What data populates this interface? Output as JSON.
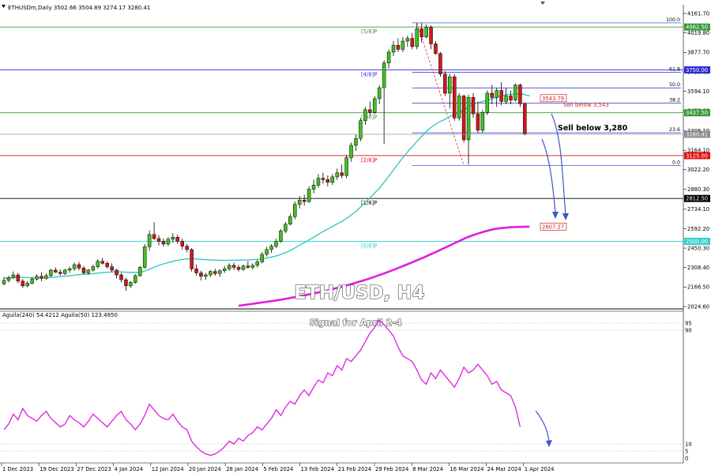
{
  "header": {
    "symbol_text": "ETHUSDm,Daily  3502.66 3504.89 3274.17 3280.41",
    "indicator_text": "Aguila(240) 54.4212  Aguila(50) 123.4950"
  },
  "watermark": {
    "title": "ETH/USD, H4",
    "subtitle": "Signal for April 2-4"
  },
  "colors": {
    "bull": "#3fc21f",
    "bear": "#d31818",
    "ema_fast": "#33c9c2",
    "ema_slow": "#e01ce0",
    "murray_green": "#3a9a3a",
    "murray_blue": "#2b2bd6",
    "murray_red": "#e01010",
    "murray_black": "#000000",
    "murray_cyan": "#2fd0d0",
    "arrow": "#3d55c8",
    "oscillator": "#e01ce0"
  },
  "price_axis": {
    "ticks": [
      "4161.70",
      "4019.80",
      "3877.70",
      "3735.60",
      "3594.10",
      "3452.00",
      "3306.10",
      "3164.10",
      "3022.20",
      "2880.30",
      "2734.10",
      "2592.20",
      "2450.30",
      "2308.40",
      "2166.50",
      "2024.60"
    ]
  },
  "time_axis": {
    "labels": [
      "1 Dec 2023",
      "19 Dec 2023",
      "27 Dec 2023",
      "4 Jan 2024",
      "12 Jan 2024",
      "20 Jan 2024",
      "28 Jan 2024",
      "5 Feb 2024",
      "13 Feb 2024",
      "21 Feb 2024",
      "29 Feb 2024",
      "8 Mar 2024",
      "16 Mar 2024",
      "24 Mar 2024",
      "1 Apr 2024"
    ]
  },
  "murray_levels": [
    {
      "label": "[5/8]P",
      "price": 4062.5,
      "badge": "4062.50",
      "color": "green"
    },
    {
      "label": "[4/8]P",
      "price": 3750.0,
      "badge": "3750.00",
      "color": "blue"
    },
    {
      "label": "[3/8]P",
      "price": 3437.5,
      "badge": "3437.50",
      "color": "green"
    },
    {
      "label": "[2/8]P",
      "price": 3125.0,
      "badge": "3125.00",
      "color": "red"
    },
    {
      "label": "[1/8]P",
      "price": 2812.5,
      "badge": "2812.50",
      "color": "black"
    },
    {
      "label": "[0/8]P",
      "price": 2500.0,
      "badge": "2500.00",
      "color": "cyan"
    }
  ],
  "fibonacci": {
    "levels": [
      {
        "label": "100.0",
        "price": 4093
      },
      {
        "label": "61.8",
        "price": 3732
      },
      {
        "label": "50.0",
        "price": 3619
      },
      {
        "label": "38.2",
        "price": 3508
      },
      {
        "label": "23.6",
        "price": 3291
      },
      {
        "label": "0.0",
        "price": 3054
      }
    ]
  },
  "price_markers": [
    {
      "text": "3280.41",
      "price": 3280.41,
      "style": "current"
    },
    {
      "text": "3543.79",
      "price": 3543.79,
      "style": "red"
    },
    {
      "text": "2607.27",
      "price": 2607.27,
      "style": "red"
    }
  ],
  "annotations": {
    "sell_small": "Sell below 3,543",
    "sell_big": "Sell below 3,280"
  },
  "oscillator_axis": {
    "ticks": [
      "95",
      "90",
      "10",
      "5",
      "0"
    ]
  },
  "chart_data": {
    "type": "candlestick",
    "title": "ETH/USD, H4",
    "ylim": [
      2000,
      4200
    ],
    "candles": [
      [
        2190,
        2240,
        2180,
        2215
      ],
      [
        2215,
        2250,
        2200,
        2235
      ],
      [
        2235,
        2280,
        2225,
        2255
      ],
      [
        2255,
        2270,
        2195,
        2210
      ],
      [
        2210,
        2225,
        2160,
        2175
      ],
      [
        2175,
        2210,
        2165,
        2195
      ],
      [
        2195,
        2240,
        2185,
        2225
      ],
      [
        2225,
        2260,
        2215,
        2245
      ],
      [
        2245,
        2275,
        2210,
        2230
      ],
      [
        2230,
        2265,
        2220,
        2250
      ],
      [
        2250,
        2300,
        2240,
        2290
      ],
      [
        2290,
        2310,
        2270,
        2275
      ],
      [
        2275,
        2295,
        2250,
        2265
      ],
      [
        2265,
        2300,
        2255,
        2290
      ],
      [
        2290,
        2315,
        2270,
        2300
      ],
      [
        2300,
        2345,
        2285,
        2330
      ],
      [
        2330,
        2350,
        2290,
        2305
      ],
      [
        2305,
        2320,
        2260,
        2270
      ],
      [
        2270,
        2300,
        2255,
        2290
      ],
      [
        2290,
        2330,
        2280,
        2315
      ],
      [
        2315,
        2370,
        2300,
        2355
      ],
      [
        2355,
        2380,
        2330,
        2340
      ],
      [
        2340,
        2355,
        2300,
        2315
      ],
      [
        2315,
        2340,
        2275,
        2290
      ],
      [
        2290,
        2300,
        2230,
        2255
      ],
      [
        2255,
        2270,
        2200,
        2220
      ],
      [
        2220,
        2235,
        2140,
        2175
      ],
      [
        2175,
        2210,
        2160,
        2200
      ],
      [
        2200,
        2260,
        2190,
        2250
      ],
      [
        2250,
        2320,
        2240,
        2310
      ],
      [
        2310,
        2480,
        2300,
        2460
      ],
      [
        2460,
        2580,
        2430,
        2550
      ],
      [
        2550,
        2640,
        2510,
        2520
      ],
      [
        2520,
        2545,
        2470,
        2500
      ],
      [
        2500,
        2520,
        2460,
        2480
      ],
      [
        2480,
        2530,
        2465,
        2515
      ],
      [
        2515,
        2560,
        2490,
        2530
      ],
      [
        2530,
        2550,
        2480,
        2500
      ],
      [
        2500,
        2520,
        2440,
        2465
      ],
      [
        2465,
        2480,
        2420,
        2440
      ],
      [
        2440,
        2450,
        2280,
        2300
      ],
      [
        2300,
        2330,
        2250,
        2270
      ],
      [
        2270,
        2285,
        2215,
        2245
      ],
      [
        2245,
        2270,
        2220,
        2255
      ],
      [
        2255,
        2290,
        2240,
        2280
      ],
      [
        2280,
        2300,
        2250,
        2265
      ],
      [
        2265,
        2295,
        2240,
        2285
      ],
      [
        2285,
        2320,
        2270,
        2300
      ],
      [
        2300,
        2340,
        2285,
        2325
      ],
      [
        2325,
        2345,
        2290,
        2310
      ],
      [
        2310,
        2330,
        2280,
        2295
      ],
      [
        2295,
        2330,
        2285,
        2320
      ],
      [
        2320,
        2355,
        2300,
        2310
      ],
      [
        2310,
        2340,
        2295,
        2325
      ],
      [
        2325,
        2365,
        2310,
        2350
      ],
      [
        2350,
        2420,
        2340,
        2405
      ],
      [
        2405,
        2460,
        2390,
        2440
      ],
      [
        2440,
        2480,
        2415,
        2465
      ],
      [
        2465,
        2520,
        2450,
        2500
      ],
      [
        2500,
        2590,
        2490,
        2575
      ],
      [
        2575,
        2640,
        2560,
        2625
      ],
      [
        2625,
        2700,
        2615,
        2680
      ],
      [
        2680,
        2790,
        2660,
        2770
      ],
      [
        2770,
        2830,
        2740,
        2800
      ],
      [
        2800,
        2840,
        2760,
        2790
      ],
      [
        2790,
        2900,
        2780,
        2880
      ],
      [
        2880,
        2950,
        2850,
        2910
      ],
      [
        2910,
        2990,
        2890,
        2960
      ],
      [
        2960,
        3000,
        2920,
        2950
      ],
      [
        2950,
        2980,
        2900,
        2930
      ],
      [
        2930,
        2990,
        2910,
        2970
      ],
      [
        2970,
        3030,
        2950,
        3000
      ],
      [
        3000,
        3060,
        2960,
        2980
      ],
      [
        2980,
        3130,
        2960,
        3110
      ],
      [
        3110,
        3220,
        3080,
        3200
      ],
      [
        3200,
        3280,
        3160,
        3250
      ],
      [
        3250,
        3400,
        3230,
        3380
      ],
      [
        3380,
        3480,
        3350,
        3460
      ],
      [
        3460,
        3520,
        3420,
        3440
      ],
      [
        3440,
        3560,
        3430,
        3540
      ],
      [
        3540,
        3640,
        3500,
        3620
      ],
      [
        3620,
        3820,
        3210,
        3800
      ],
      [
        3800,
        3900,
        3760,
        3880
      ],
      [
        3880,
        3960,
        3850,
        3930
      ],
      [
        3930,
        3980,
        3880,
        3900
      ],
      [
        3900,
        3990,
        3880,
        3960
      ],
      [
        3960,
        4000,
        3920,
        3980
      ],
      [
        3980,
        4020,
        3900,
        3920
      ],
      [
        3920,
        4090,
        3900,
        4050
      ],
      [
        4050,
        4090,
        3950,
        3990
      ],
      [
        3990,
        4080,
        3980,
        4060
      ],
      [
        4060,
        4075,
        3900,
        3940
      ],
      [
        3940,
        3960,
        3860,
        3870
      ],
      [
        3870,
        3880,
        3700,
        3720
      ],
      [
        3720,
        3740,
        3560,
        3580
      ],
      [
        3580,
        3720,
        3470,
        3700
      ],
      [
        3700,
        3720,
        3380,
        3400
      ],
      [
        3400,
        3580,
        3380,
        3560
      ],
      [
        3560,
        3570,
        3220,
        3240
      ],
      [
        3240,
        3570,
        3060,
        3550
      ],
      [
        3550,
        3580,
        3400,
        3430
      ],
      [
        3430,
        3520,
        3290,
        3310
      ],
      [
        3310,
        3460,
        3290,
        3440
      ],
      [
        3440,
        3600,
        3420,
        3580
      ],
      [
        3580,
        3640,
        3500,
        3550
      ],
      [
        3550,
        3620,
        3480,
        3600
      ],
      [
        3600,
        3660,
        3490,
        3520
      ],
      [
        3520,
        3620,
        3500,
        3560
      ],
      [
        3560,
        3600,
        3500,
        3530
      ],
      [
        3530,
        3650,
        3520,
        3640
      ],
      [
        3640,
        3650,
        3480,
        3502.66
      ],
      [
        3502.66,
        3504.89,
        3274.17,
        3280.41
      ]
    ],
    "ema_fast": [
      2232,
      2234,
      2236,
      2238,
      2238,
      2236,
      2234,
      2233,
      2233,
      2235,
      2237,
      2240,
      2243,
      2246,
      2249,
      2253,
      2257,
      2260,
      2262,
      2264,
      2268,
      2272,
      2275,
      2277,
      2278,
      2277,
      2275,
      2273,
      2273,
      2274,
      2283,
      2296,
      2312,
      2324,
      2335,
      2345,
      2354,
      2362,
      2368,
      2372,
      2373,
      2371,
      2368,
      2366,
      2364,
      2363,
      2362,
      2361,
      2362,
      2362,
      2363,
      2364,
      2364,
      2366,
      2368,
      2372,
      2378,
      2385,
      2393,
      2404,
      2418,
      2433,
      2452,
      2472,
      2490,
      2510,
      2530,
      2551,
      2571,
      2590,
      2608,
      2627,
      2645,
      2667,
      2692,
      2718,
      2750,
      2784,
      2818,
      2852,
      2888,
      2930,
      2975,
      3020,
      3065,
      3110,
      3152,
      3190,
      3228,
      3265,
      3300,
      3330,
      3355,
      3375,
      3390,
      3410,
      3428,
      3440,
      3458,
      3480,
      3500,
      3510,
      3520,
      3530,
      3540,
      3550,
      3560,
      3570,
      3570,
      3575,
      3575,
      3570,
      3560
    ],
    "ema_slow_x_start": 50,
    "ema_slow": [
      2030,
      2036,
      2042,
      2048,
      2054,
      2060,
      2066,
      2073,
      2080,
      2088,
      2096,
      2104,
      2112,
      2121,
      2130,
      2140,
      2150,
      2161,
      2172,
      2184,
      2196,
      2209,
      2222,
      2236,
      2251,
      2266,
      2282,
      2298,
      2315,
      2332,
      2350,
      2368,
      2386,
      2405,
      2424,
      2444,
      2464,
      2484,
      2504,
      2524,
      2540,
      2555,
      2568,
      2580,
      2590,
      2596,
      2600,
      2603,
      2605,
      2606,
      2607
    ],
    "aguila": [
      20,
      24,
      31,
      27,
      35,
      30,
      28,
      26,
      30,
      33,
      28,
      25,
      22,
      24,
      30,
      27,
      25,
      22,
      26,
      31,
      28,
      25,
      22,
      26,
      30,
      33,
      27,
      24,
      20,
      24,
      30,
      38,
      34,
      30,
      28,
      27,
      31,
      26,
      22,
      20,
      12,
      8,
      5,
      3,
      2,
      3,
      5,
      8,
      12,
      10,
      14,
      12,
      16,
      18,
      22,
      20,
      24,
      28,
      34,
      30,
      36,
      40,
      38,
      44,
      48,
      44,
      50,
      55,
      53,
      60,
      58,
      65,
      62,
      70,
      68,
      72,
      76,
      82,
      88,
      92,
      97,
      94,
      90,
      86,
      78,
      72,
      70,
      68,
      62,
      55,
      52,
      60,
      56,
      62,
      58,
      54,
      50,
      56,
      64,
      60,
      62,
      66,
      62,
      58,
      52,
      54,
      48,
      46,
      44,
      36,
      22
    ]
  }
}
